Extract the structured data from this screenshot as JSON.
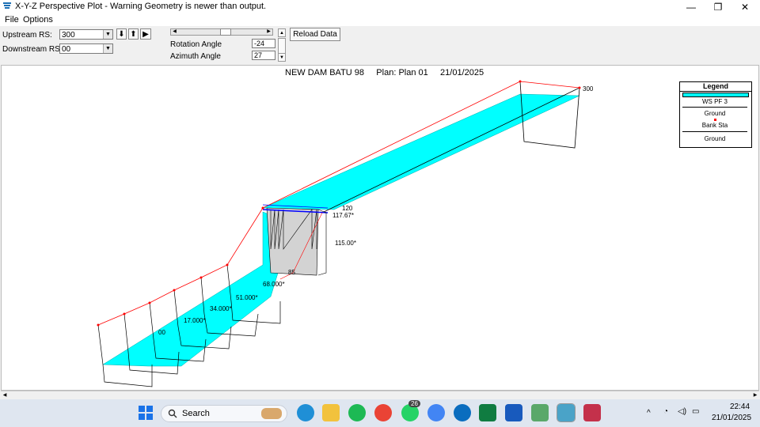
{
  "window": {
    "title": "X-Y-Z Perspective Plot - Warning Geometry is newer than output.",
    "minimize_icon": "minimize-icon",
    "restore_icon": "restore-icon",
    "close_icon": "close-icon",
    "minimize_glyph": "—",
    "restore_glyph": "❐",
    "close_glyph": "✕"
  },
  "menu": {
    "items": [
      "File",
      "Options"
    ]
  },
  "toolbar": {
    "upstream_label": "Upstream RS:",
    "upstream_value": "300",
    "downstream_label": "Downstream RS:",
    "downstream_value": "00",
    "btn_down": "⬇",
    "btn_up": "⬆",
    "btn_play": "▶",
    "rotation_label": "Rotation Angle",
    "rotation_value": "-24",
    "azimuth_label": "Azimuth Angle",
    "azimuth_value": "27",
    "reload_label": "Reload Data"
  },
  "plot": {
    "title": "NEW DAM BATU 98     Plan: Plan 01     21/01/2025",
    "station_labels": [
      "300",
      "120",
      "117.67*",
      "115.00*",
      "85",
      "68.000*",
      "51.000*",
      "34.000*",
      "17.000*",
      "00"
    ],
    "colors": {
      "water": "#00ffff",
      "ground": "#000000",
      "bank": "#ff0000",
      "structure": "#d3d3d3",
      "gate": "#0000ff"
    }
  },
  "legend": {
    "title": "Legend",
    "items": [
      "WS PF 3",
      "Ground",
      "Bank Sta",
      "Ground"
    ]
  },
  "taskbar": {
    "search_label": "Search",
    "badge_count": "26",
    "time": "22:44",
    "date": "21/01/2025"
  }
}
